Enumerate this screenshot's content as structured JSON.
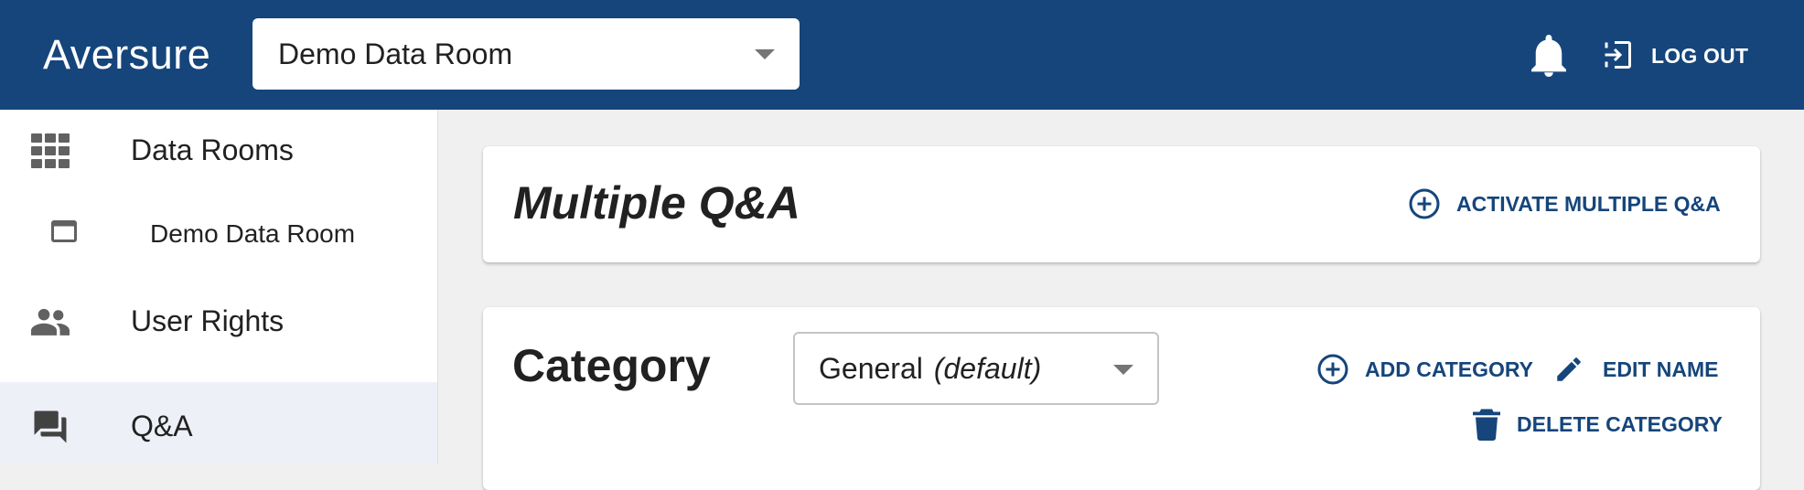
{
  "header": {
    "logo": "Aversure",
    "room_select": {
      "value": "Demo Data Room"
    },
    "logout_label": "LOG OUT",
    "icons": {
      "notifications": "bell-icon",
      "logout": "logout-icon"
    }
  },
  "sidebar": {
    "items": [
      {
        "label": "Data Rooms",
        "icon": "grid-icon",
        "active": false
      },
      {
        "label": "Demo Data Room",
        "icon": "window-icon",
        "active": false,
        "sub": true
      },
      {
        "label": "User Rights",
        "icon": "people-icon",
        "active": false
      },
      {
        "label": "Q&A",
        "icon": "forum-icon",
        "active": true
      }
    ]
  },
  "multiple_qa": {
    "title": "Multiple Q&A",
    "activate_label": "ACTIVATE MULTIPLE Q&A"
  },
  "category": {
    "title": "Category",
    "select_value": "General",
    "select_note": "(default)",
    "add_label": "ADD CATEGORY",
    "edit_label": "EDIT NAME",
    "delete_label": "DELETE CATEGORY"
  },
  "colors": {
    "brand": "#15457b",
    "active_nav_bg": "#edf0f7",
    "page_bg": "#f0f0f0"
  }
}
